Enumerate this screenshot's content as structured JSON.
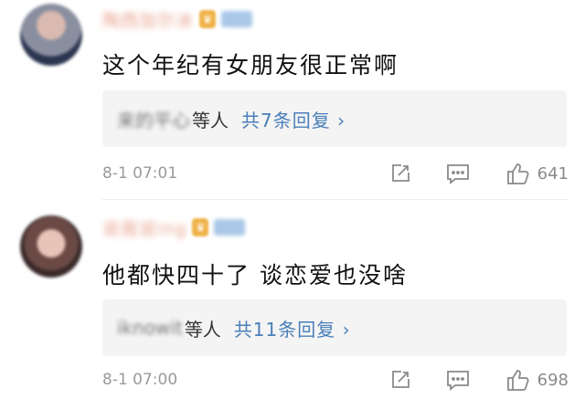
{
  "comments": [
    {
      "nickname": "陶西加尔冰",
      "text": "这个年纪有女朋友很正常啊",
      "reply_names": "来的平心",
      "reply_suffix": "等人",
      "reply_link": "共7条回复 ›",
      "timestamp": "8-1 07:01",
      "likes": "641"
    },
    {
      "nickname": "说我说ing",
      "text": "他都快四十了 谈恋爱也没啥",
      "reply_names": "iknowit",
      "reply_suffix": "等人",
      "reply_link": "共11条回复 ›",
      "timestamp": "8-1 07:00",
      "likes": "698"
    }
  ],
  "icons": {
    "edit": "edit-icon",
    "comment": "comment-icon",
    "like": "thumbs-up-icon",
    "badge": "vip-badge-icon",
    "level": "level-badge-icon"
  },
  "colors": {
    "reply_link": "#4a7fb8",
    "timestamp": "#9a9a9a",
    "reply_bg": "#f4f4f4"
  }
}
